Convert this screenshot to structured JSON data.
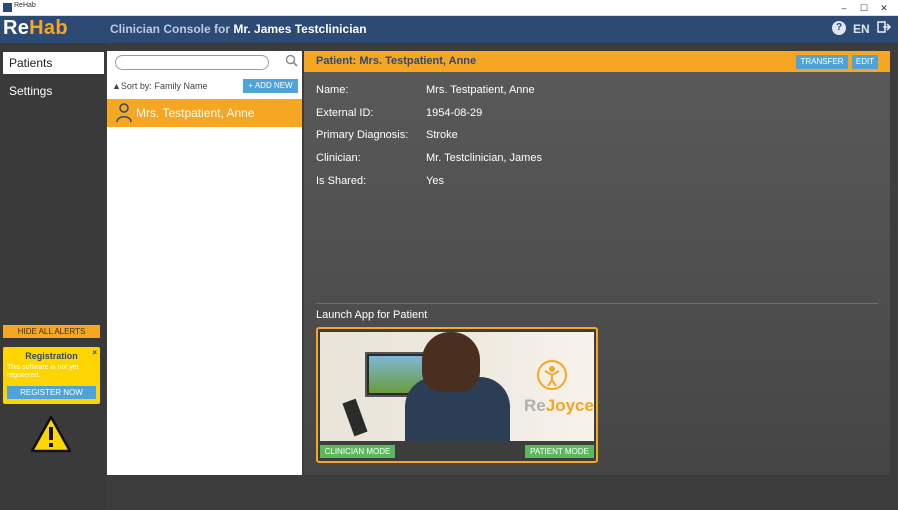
{
  "window": {
    "title": "ReHab",
    "minimize": "–",
    "maximize": "☐",
    "close": "✕"
  },
  "header": {
    "logo_re": "Re",
    "logo_hab": "Hab",
    "console_prefix": "Clinician Console for ",
    "console_user": "Mr. James Testclinician",
    "help": "?",
    "language": "EN",
    "exit_icon": "exit-icon"
  },
  "sidebar": {
    "items": [
      {
        "label": "Patients"
      },
      {
        "label": "Settings"
      }
    ],
    "hide_alerts": "HIDE ALL ALERTS",
    "registration": {
      "title": "Registration",
      "close": "×",
      "text": "This software is not yet registered.",
      "button": "REGISTER NOW"
    }
  },
  "patient_list": {
    "search_placeholder": "",
    "sort_label": "Sort by:",
    "sort_value": "Family Name",
    "add_new": "+ ADD NEW",
    "patients": [
      {
        "name": "Mrs. Testpatient, Anne"
      }
    ]
  },
  "detail": {
    "title": "Patient: Mrs. Testpatient, Anne",
    "transfer": "TRANSFER",
    "edit": "EDIT",
    "fields": [
      {
        "label": "Name:",
        "value": "Mrs. Testpatient, Anne"
      },
      {
        "label": "External ID:",
        "value": "1954-08-29"
      },
      {
        "label": "Primary Diagnosis:",
        "value": "Stroke"
      },
      {
        "label": "Clinician:",
        "value": "Mr. Testclinician, James"
      },
      {
        "label": "Is Shared:",
        "value": "Yes"
      }
    ],
    "launch_title": "Launch App for Patient",
    "app": {
      "brand_re": "Re",
      "brand_joyce": "Joyce",
      "clinician_mode": "CLINICIAN MODE",
      "patient_mode": "PATIENT MODE"
    }
  },
  "colors": {
    "accent": "#f5a623",
    "header": "#2d4a75",
    "button": "#4ea3d9",
    "mode_button": "#5cb85c"
  }
}
